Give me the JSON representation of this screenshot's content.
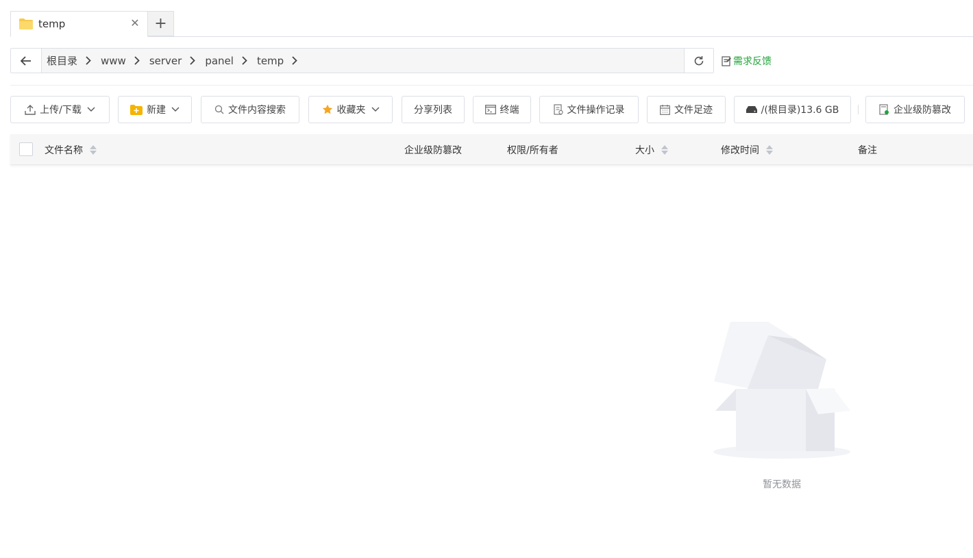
{
  "tabs": [
    {
      "label": "temp",
      "icon": "folder-icon"
    }
  ],
  "tab_add_icon": "plus-icon",
  "path": {
    "crumbs": [
      "根目录",
      "www",
      "server",
      "panel",
      "temp"
    ]
  },
  "feedback": {
    "label": "需求反馈",
    "color": "#20a53a"
  },
  "toolbar": {
    "upload": "上传/下载",
    "new": "新建",
    "search": "文件内容搜索",
    "favorites": "收藏夹",
    "share": "分享列表",
    "terminal": "终端",
    "oplog": "文件操作记录",
    "footprint": "文件足迹",
    "disk": "/(根目录)13.6 GB",
    "tamper": "企业级防篡改"
  },
  "table": {
    "columns": {
      "name": "文件名称",
      "tamper": "企业级防篡改",
      "perm": "权限/所有者",
      "size": "大小",
      "mtime": "修改时间",
      "note": "备注"
    }
  },
  "empty": {
    "text": "暂无数据"
  }
}
